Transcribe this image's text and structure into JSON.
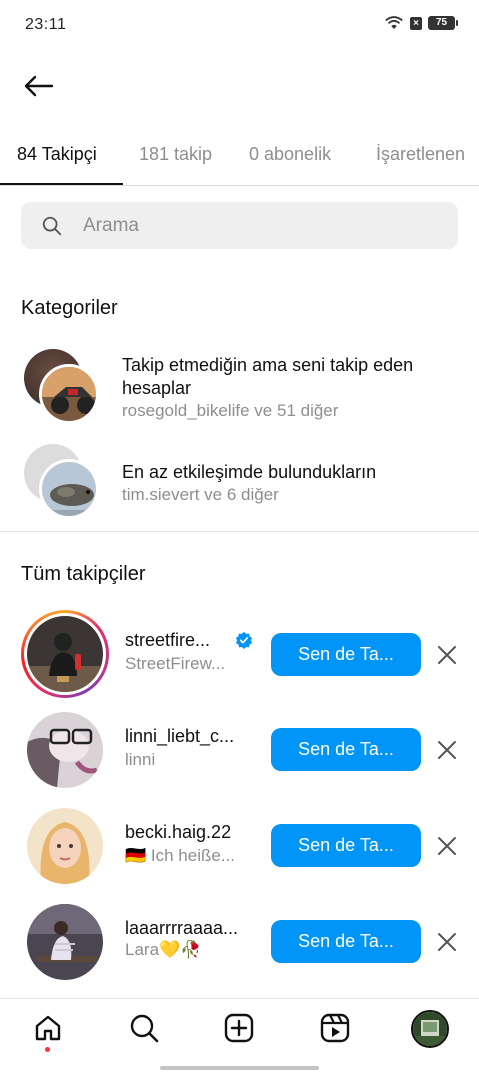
{
  "status_bar": {
    "time": "23:11",
    "battery": "75",
    "icons": [
      "wifi-icon",
      "sim-off-icon",
      "battery-icon"
    ]
  },
  "header": {
    "back_icon": "arrow-left-icon"
  },
  "tabs": [
    {
      "label": "84 Takipçi",
      "active": true
    },
    {
      "label": "181 takip",
      "active": false
    },
    {
      "label": "0 abonelik",
      "active": false
    },
    {
      "label": "İşaretlenen",
      "active": false
    }
  ],
  "search": {
    "placeholder": "Arama",
    "icon": "search-icon"
  },
  "categories": {
    "title": "Kategoriler",
    "items": [
      {
        "title": "Takip etmediğin ama seni takip eden hesaplar",
        "subtitle": "rosegold_bikelife ve 51 diğer"
      },
      {
        "title": "En az etkileşimde bulundukların",
        "subtitle": "tim.sievert ve 6 diğer"
      }
    ]
  },
  "followers": {
    "title": "Tüm takipçiler",
    "follow_label": "Sen de Ta...",
    "items": [
      {
        "username": "streetfire...",
        "fullname": "StreetFirew...",
        "verified": true,
        "story": true
      },
      {
        "username": "linni_liebt_c...",
        "fullname": "linni",
        "verified": false,
        "story": false
      },
      {
        "username": "becki.haig.22",
        "fullname": "🇩🇪 Ich heiße...",
        "verified": false,
        "story": false
      },
      {
        "username": "laaarrrraaaa...",
        "fullname": "Lara💛🥀",
        "verified": false,
        "story": false
      }
    ]
  },
  "bottom_nav": [
    "home-icon",
    "search-icon",
    "create-icon",
    "reels-icon",
    "profile-avatar"
  ],
  "colors": {
    "accent": "#0095f6",
    "notification": "#ff3040",
    "secondary_text": "#8e8e8e"
  }
}
